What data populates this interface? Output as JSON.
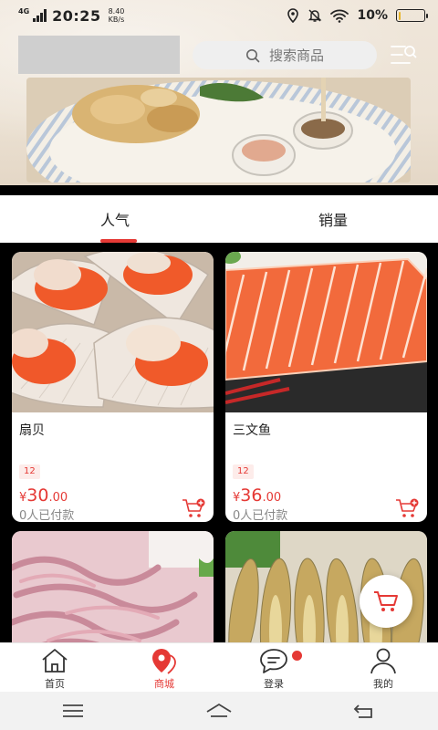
{
  "status_bar": {
    "network": "4G",
    "time": "20:25",
    "speed_value": "8.40",
    "speed_unit": "KB/s",
    "battery_percent": "10%",
    "battery_level": 0.1
  },
  "search": {
    "placeholder": "搜索商品"
  },
  "tabs": [
    {
      "label": "人气",
      "active": true
    },
    {
      "label": "销量",
      "active": false
    }
  ],
  "products": [
    {
      "name": "扇贝",
      "tag": "12",
      "currency": "¥",
      "price_int": "30",
      "price_dec": ".00",
      "paid": "0人已付款"
    },
    {
      "name": "三文鱼",
      "tag": "12",
      "currency": "¥",
      "price_int": "36",
      "price_dec": ".00",
      "paid": "0人已付款"
    },
    {
      "name": "",
      "tag": "",
      "currency": "",
      "price_int": "",
      "price_dec": "",
      "paid": ""
    },
    {
      "name": "",
      "tag": "",
      "currency": "",
      "price_int": "",
      "price_dec": "",
      "paid": ""
    }
  ],
  "bottom_nav": [
    {
      "label": "首页",
      "icon": "home-icon",
      "active": false
    },
    {
      "label": "商城",
      "icon": "shop-location-icon",
      "active": true
    },
    {
      "label": "登录",
      "icon": "chat-bubble-icon",
      "active": false,
      "badge": true
    },
    {
      "label": "我的",
      "icon": "person-icon",
      "active": false
    }
  ],
  "colors": {
    "accent": "#e53935",
    "tab_underline": "#e53935",
    "price": "#e53935"
  }
}
